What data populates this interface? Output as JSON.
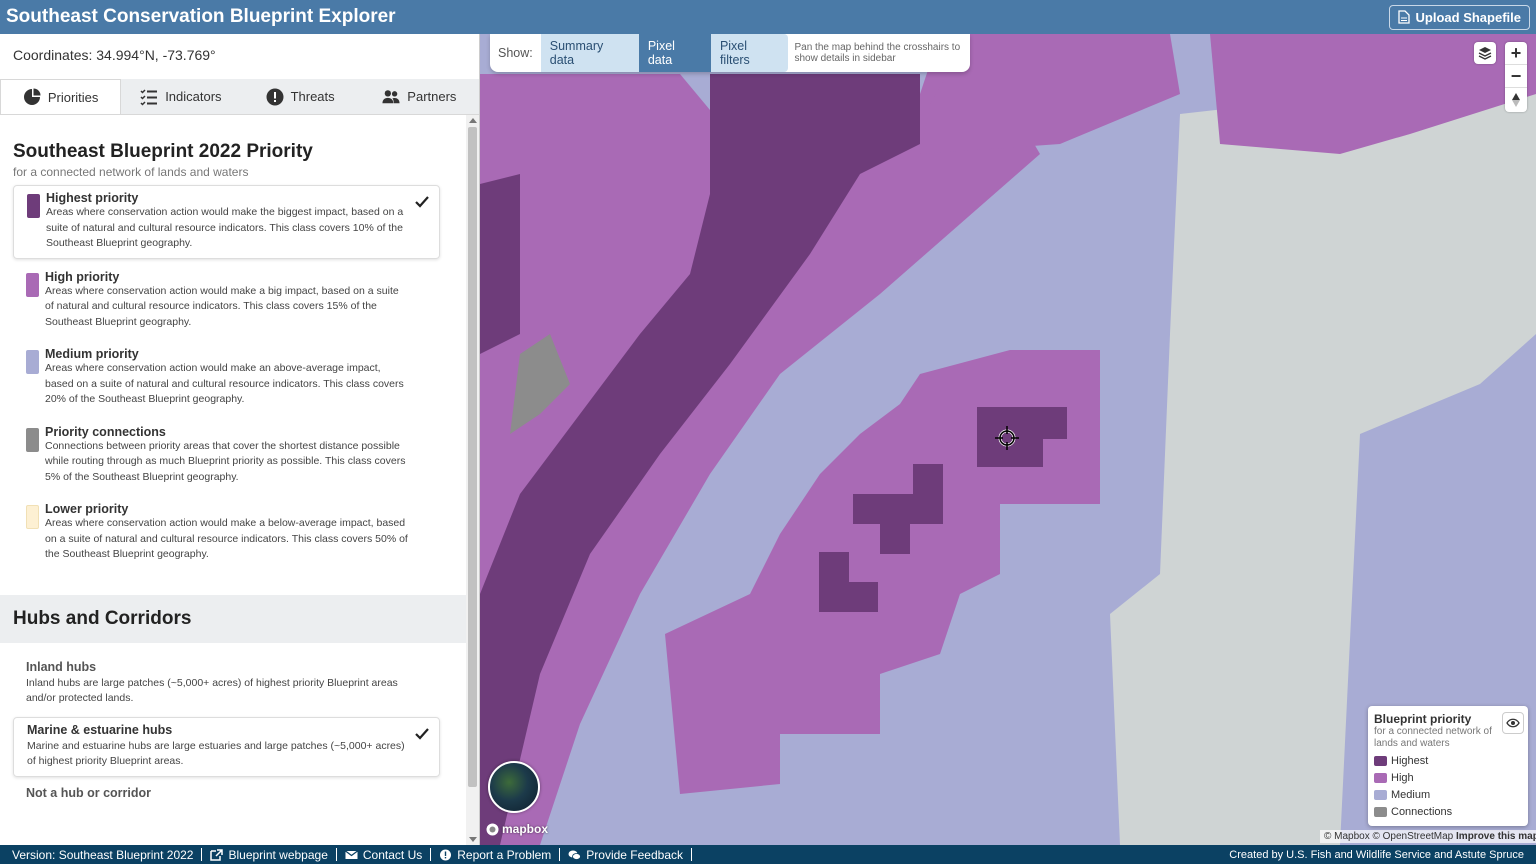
{
  "header": {
    "title": "Southeast  Conservation Blueprint Explorer",
    "upload_label": "Upload Shapefile"
  },
  "sidebar": {
    "coordinates": "Coordinates: 34.994°N, -73.769°",
    "tabs": [
      {
        "label": "Priorities",
        "icon": "pie-chart-icon",
        "active": true
      },
      {
        "label": "Indicators",
        "icon": "list-icon",
        "active": false
      },
      {
        "label": "Threats",
        "icon": "warning-icon",
        "active": false
      },
      {
        "label": "Partners",
        "icon": "users-icon",
        "active": false
      }
    ],
    "priority": {
      "title": "Southeast Blueprint 2022 Priority",
      "subtitle": "for a connected network of lands and waters",
      "items": [
        {
          "label": "Highest priority",
          "desc": "Areas where conservation action would make the biggest impact, based on a suite of natural and cultural resource indicators. This class covers 10% of the Southeast Blueprint geography.",
          "color": "#6e3c7a",
          "selected": true
        },
        {
          "label": "High priority",
          "desc": "Areas where conservation action would make a big impact, based on a suite of natural and cultural resource indicators. This class covers 15% of the Southeast Blueprint geography.",
          "color": "#a96ab5",
          "selected": false
        },
        {
          "label": "Medium priority",
          "desc": "Areas where conservation action would make an above-average impact, based on a suite of natural and cultural resource indicators. This class covers 20% of the Southeast Blueprint geography.",
          "color": "#a8acd4",
          "selected": false
        },
        {
          "label": "Priority connections",
          "desc": "Connections between priority areas that cover the shortest distance possible while routing through as much Blueprint priority as possible. This class covers 5% of the Southeast Blueprint geography.",
          "color": "#8c8c8c",
          "selected": false
        },
        {
          "label": "Lower priority",
          "desc": "Areas where conservation action would make a below-average impact, based on a suite of natural and cultural resource indicators. This class covers 50% of the Southeast Blueprint geography.",
          "color": "#fdf0d3",
          "selected": false
        }
      ]
    },
    "hubs": {
      "title": "Hubs and Corridors",
      "items": [
        {
          "label": "Inland hubs",
          "desc": "Inland hubs are large patches (~5,000+ acres) of highest priority Blueprint areas and/or protected lands.",
          "selected": false
        },
        {
          "label": "Marine & estuarine hubs",
          "desc": "Marine and estuarine hubs are large estuaries and large patches (~5,000+ acres) of highest priority Blueprint areas.",
          "selected": true
        },
        {
          "label": "Not a hub or corridor",
          "desc": "",
          "selected": false
        }
      ]
    }
  },
  "map": {
    "show_label": "Show:",
    "modes": [
      {
        "label": "Summary data",
        "active": false
      },
      {
        "label": "Pixel data",
        "active": true
      },
      {
        "label": "Pixel filters",
        "active": false
      }
    ],
    "hint": "Pan the map behind the crosshairs to show details in sidebar",
    "zoom_in": "+",
    "zoom_out": "−",
    "mapbox_label": "mapbox",
    "attribution": "© Mapbox © OpenStreetMap",
    "improve": "Improve this map",
    "legend": {
      "title": "Blueprint priority",
      "subtitle": "for a connected network of lands and waters",
      "entries": [
        {
          "label": "Highest",
          "color": "#6e3c7a"
        },
        {
          "label": "High",
          "color": "#a96ab5"
        },
        {
          "label": "Medium",
          "color": "#a8acd4"
        },
        {
          "label": "Connections",
          "color": "#8c8c8c"
        }
      ]
    }
  },
  "footer": {
    "version": "Version: Southeast Blueprint 2022",
    "links": [
      "Blueprint webpage",
      "Contact Us",
      "Report a Problem",
      "Provide Feedback"
    ],
    "credit": "Created by U.S. Fish and Wildlife Service and Astute Spruce"
  },
  "colors": {
    "header_bg": "#4a7aa7",
    "footer_bg": "#0b4163",
    "highest": "#6e3c7a",
    "high": "#a96ab5",
    "medium": "#a8acd4",
    "connections": "#8c8c8c",
    "lower": "#fdf0d3"
  }
}
